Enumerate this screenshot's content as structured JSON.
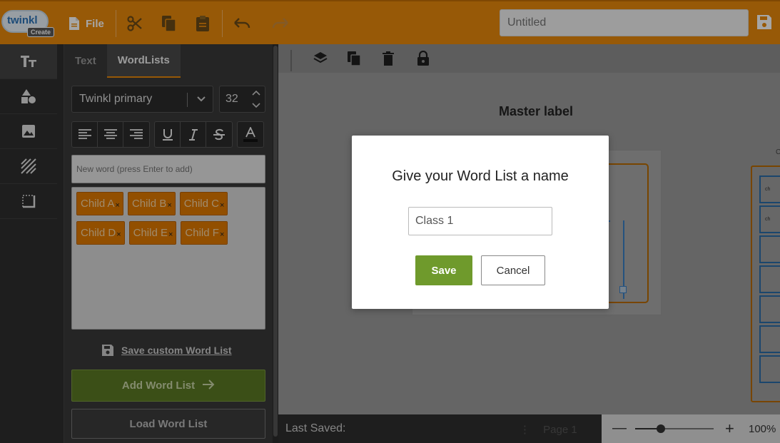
{
  "app": {
    "logo_text": "twinkl",
    "logo_badge": "Create",
    "accent_color": "#e9890c"
  },
  "topbar": {
    "file_label": "File",
    "title_placeholder": "Untitled",
    "icons": [
      "file-icon",
      "cut-icon",
      "copy-icon",
      "paste-icon",
      "undo-icon",
      "redo-icon",
      "save-icon"
    ]
  },
  "rail": {
    "items": [
      "text-icon",
      "shapes-icon",
      "image-icon",
      "pattern-icon",
      "border-icon"
    ]
  },
  "panel": {
    "tabs": [
      {
        "label": "Text",
        "active": false
      },
      {
        "label": "WordLists",
        "active": true
      }
    ],
    "font": "Twinkl primary",
    "font_size": "32",
    "new_word_placeholder": "New word (press Enter to add)",
    "words": [
      "Child A",
      "Child B",
      "Child C",
      "Child D",
      "Child E",
      "Child F"
    ],
    "remove_glyph": "×",
    "save_custom_label": "Save custom Word List",
    "add_button": "Add Word List",
    "load_button": "Load Word List"
  },
  "canvas": {
    "master_label": "Master label",
    "right_card_title": "C",
    "right_card_cells": [
      "ch",
      "ch"
    ]
  },
  "status": {
    "last_saved_label": "Last Saved:",
    "page_label": "Page 1",
    "zoom_label": "100%",
    "zoom_fraction": 0.33
  },
  "modal": {
    "title": "Give your Word List a name",
    "input_value": "Class 1",
    "save_label": "Save",
    "cancel_label": "Cancel"
  }
}
